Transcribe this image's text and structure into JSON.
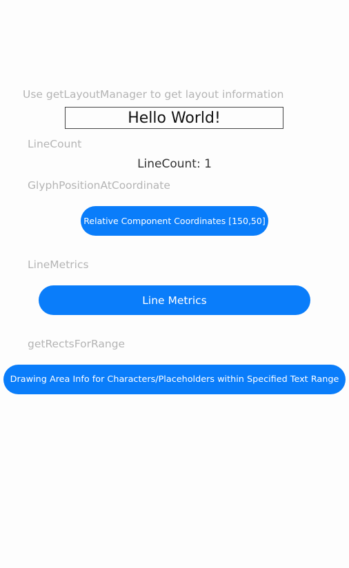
{
  "intro": {
    "text": "Use getLayoutManager to get layout information"
  },
  "hello_text": "Hello World!",
  "line_count": {
    "label": "LineCount",
    "value_text": "LineCount: 1"
  },
  "glyph_position": {
    "label": "GlyphPositionAtCoordinate",
    "button_label": "Relative Component Coordinates [150,50]"
  },
  "line_metrics": {
    "label": "LineMetrics",
    "button_label": "Line Metrics"
  },
  "rects_for_range": {
    "label": "getRectsForRange",
    "button_label": "Drawing Area Info for Characters/Placeholders within Specified Text Range"
  },
  "colors": {
    "accent": "#0a7dfa",
    "label_gray": "#b4b4b4",
    "background": "#fdfdfd"
  }
}
